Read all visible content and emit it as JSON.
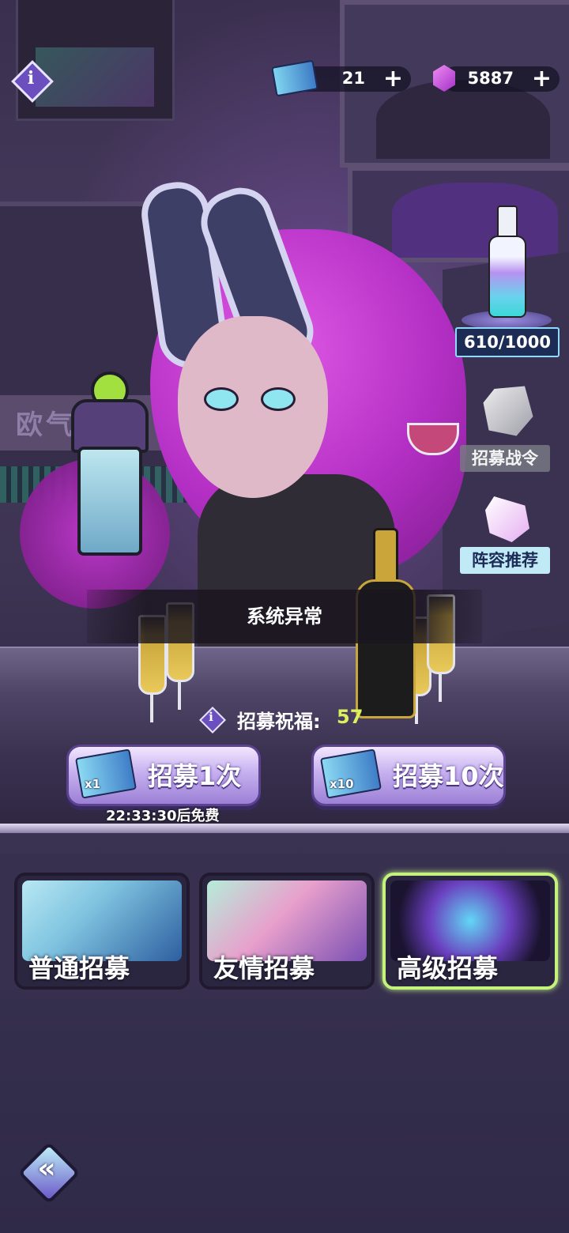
{
  "topbar": {
    "info_icon": "info-icon",
    "tickets": {
      "icon": "recruit-ticket-icon",
      "value": "21",
      "plus": "+"
    },
    "gems": {
      "icon": "gem-icon",
      "value": "5887",
      "plus": "+"
    }
  },
  "background": {
    "sign_text": "欧气"
  },
  "side": {
    "bottle_progress": {
      "icon": "bottle-icon",
      "text": "610/1000",
      "current": 610,
      "max": 1000
    },
    "war_order": {
      "icon": "war-order-icon",
      "label": "招募战令"
    },
    "lineup": {
      "icon": "lineup-icon",
      "label": "阵容推荐"
    }
  },
  "notice": {
    "text": "系统异常"
  },
  "blessing": {
    "info_glyph": "i",
    "label": "招募祝福:",
    "value": "57"
  },
  "recruit": {
    "single": {
      "multiplier": "x1",
      "label": "招募1次"
    },
    "ten": {
      "multiplier": "x10",
      "label": "招募10次"
    },
    "free_timer": "22:33:30后免费"
  },
  "modes": [
    {
      "label": "普通招募",
      "selected": false
    },
    {
      "label": "友情招募",
      "selected": false
    },
    {
      "label": "高级招募",
      "selected": true
    }
  ],
  "colors": {
    "accent_green": "#d9f15e",
    "selected_border": "#c4f27d",
    "button_purple": "#9c80d6"
  },
  "nav": {
    "back_glyph": "«",
    "back_icon": "back-icon"
  }
}
